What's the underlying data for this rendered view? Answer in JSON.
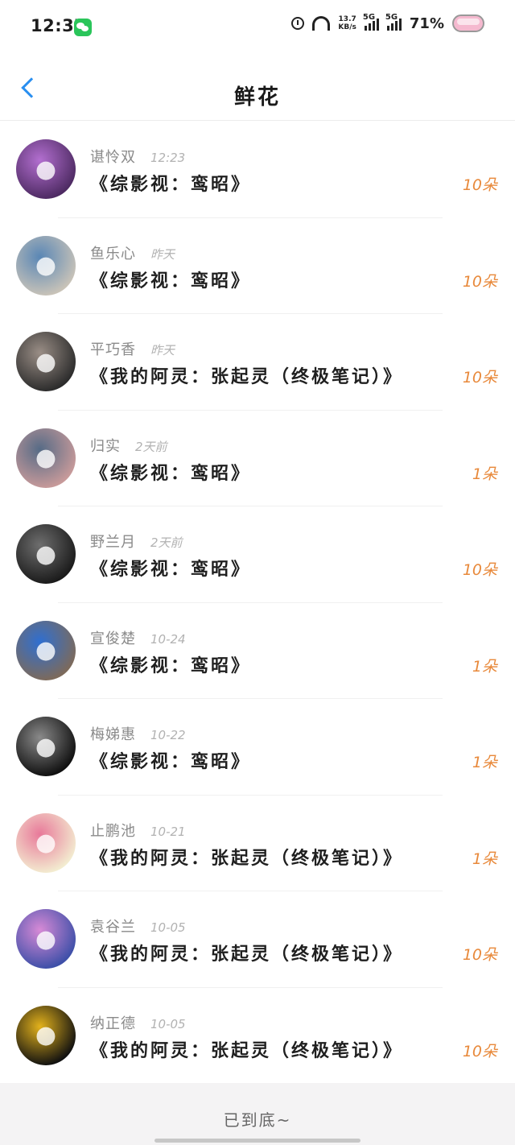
{
  "status": {
    "time": "12:37",
    "net_speed_value": "13.7",
    "net_speed_unit": "KB/s",
    "sim1": "5G",
    "sim2": "5G",
    "battery": "71%"
  },
  "header": {
    "title": "鲜花"
  },
  "items": [
    {
      "name": "谌怜双",
      "time": "12:23",
      "book": "《综影视：鸾昭》",
      "count": "10朵",
      "avatar_colors": [
        "#4d2a62",
        "#b36fd0"
      ],
      "avatar_icon": "woman-anime"
    },
    {
      "name": "鱼乐心",
      "time": "昨天",
      "book": "《综影视：鸾昭》",
      "count": "10朵",
      "avatar_colors": [
        "#c9c3b8",
        "#5a87b5"
      ],
      "avatar_icon": "man-hat"
    },
    {
      "name": "平巧香",
      "time": "昨天",
      "book": "《我的阿灵：张起灵（终极笔记）》",
      "count": "10朵",
      "avatar_colors": [
        "#2b2b2b",
        "#9a8e86"
      ],
      "avatar_icon": "man-dark"
    },
    {
      "name": "归实",
      "time": "2天前",
      "book": "《综影视：鸾昭》",
      "count": "1朵",
      "avatar_colors": [
        "#c89a9a",
        "#566b86"
      ],
      "avatar_icon": "sunset"
    },
    {
      "name": "野兰月",
      "time": "2天前",
      "book": "《综影视：鸾昭》",
      "count": "10朵",
      "avatar_colors": [
        "#1a1a1a",
        "#6e6e6e"
      ],
      "avatar_icon": "man-dark"
    },
    {
      "name": "宣俊楚",
      "time": "10-24",
      "book": "《综影视：鸾昭》",
      "count": "1朵",
      "avatar_colors": [
        "#7d6a5a",
        "#2f6fd1"
      ],
      "avatar_icon": "boy-hat"
    },
    {
      "name": "梅娣惠",
      "time": "10-22",
      "book": "《综影视：鸾昭》",
      "count": "1朵",
      "avatar_colors": [
        "#0f0f0f",
        "#8a8a8a"
      ],
      "avatar_icon": "man-bw"
    },
    {
      "name": "止鹏池",
      "time": "10-21",
      "book": "《我的阿灵：张起灵（终极笔记）》",
      "count": "1朵",
      "avatar_colors": [
        "#f3ecd0",
        "#e8799a"
      ],
      "avatar_icon": "rose"
    },
    {
      "name": "袁谷兰",
      "time": "10-05",
      "book": "《我的阿灵：张起灵（终极笔记）》",
      "count": "10朵",
      "avatar_colors": [
        "#3d4fa8",
        "#d78ad6"
      ],
      "avatar_icon": "girl-anime"
    },
    {
      "name": "纳正德",
      "time": "10-05",
      "book": "《我的阿灵：张起灵（终极笔记）》",
      "count": "10朵",
      "avatar_colors": [
        "#101010",
        "#e3b21c"
      ],
      "avatar_icon": "car"
    }
  ],
  "footer": {
    "end_text": "已到底~"
  }
}
